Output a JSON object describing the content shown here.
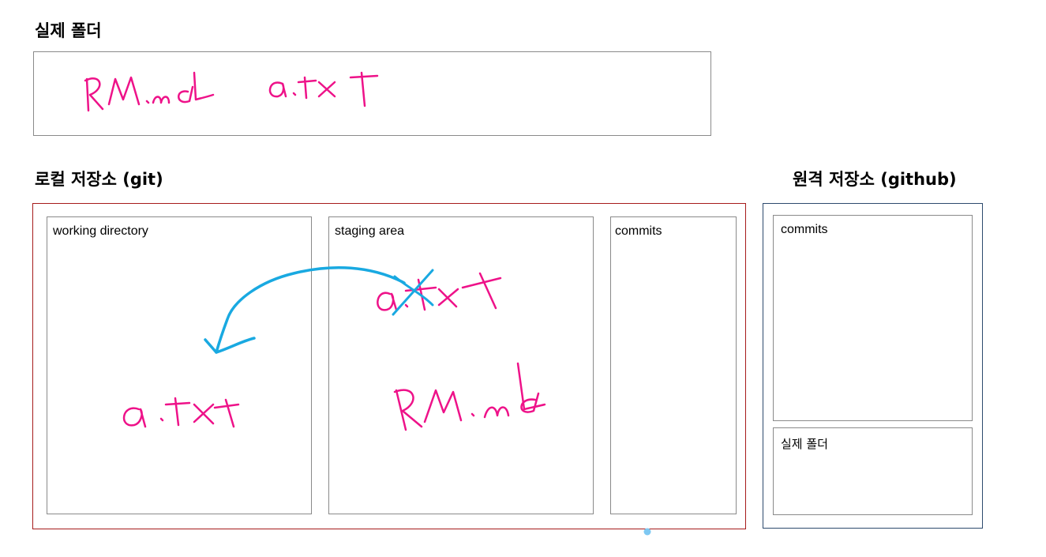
{
  "real_folder": {
    "title": "실제 폴더"
  },
  "local_repo": {
    "title": "로컬 저장소 (git)",
    "frame_color": "#a61b1b",
    "sections": {
      "working_directory": "working directory",
      "staging_area": "staging area",
      "commits": "commits"
    }
  },
  "remote_repo": {
    "title": "원격 저장소 (github)",
    "frame_color": "#2d4a6d",
    "sections": {
      "commits": "commits",
      "real_folder": "실제 폴더"
    }
  },
  "handwriting": {
    "ink_color": "#ee1289",
    "arrow_color": "#19a9e1",
    "dot_color": "#7ec8f2",
    "notes": [
      "RM.md",
      "a.txt",
      "a.txt",
      "a.txt",
      "RM.md"
    ]
  }
}
